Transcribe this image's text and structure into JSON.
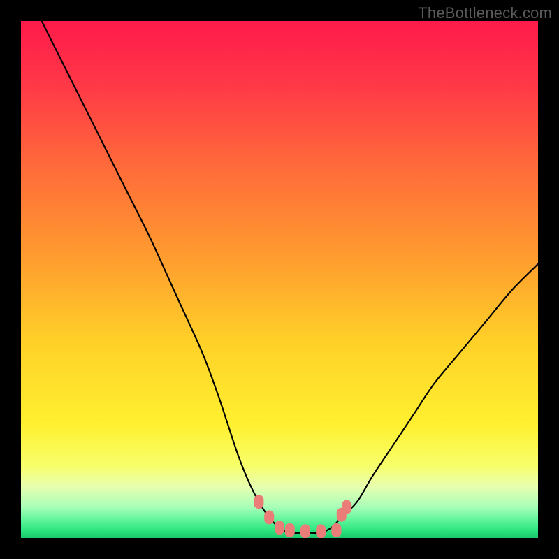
{
  "watermark": "TheBottleneck.com",
  "chart_data": {
    "type": "line",
    "title": "",
    "xlabel": "",
    "ylabel": "",
    "xlim": [
      0,
      100
    ],
    "ylim": [
      0,
      100
    ],
    "grid": false,
    "legend": false,
    "series": [
      {
        "name": "bottleneck-curve",
        "x": [
          4,
          10,
          15,
          20,
          25,
          30,
          35,
          38,
          40,
          42,
          44,
          46,
          48,
          50,
          52,
          54,
          56,
          58,
          60,
          62,
          65,
          68,
          72,
          76,
          80,
          85,
          90,
          95,
          100
        ],
        "y": [
          100,
          88,
          78,
          68,
          58,
          47,
          36,
          28,
          22,
          16,
          11,
          7,
          4,
          2,
          1,
          1,
          1,
          1,
          2,
          4,
          7,
          12,
          18,
          24,
          30,
          36,
          42,
          48,
          53
        ]
      }
    ],
    "markers": {
      "name": "highlight-dots",
      "color": "#eb7d78",
      "points_x": [
        46,
        48,
        50,
        52,
        55,
        58,
        61,
        62,
        63
      ],
      "points_y": [
        7,
        4,
        2,
        1.5,
        1.3,
        1.3,
        1.5,
        4.5,
        6
      ]
    },
    "background_gradient_stops": [
      {
        "offset": 0.0,
        "color": "#ff1a4a"
      },
      {
        "offset": 0.12,
        "color": "#ff3747"
      },
      {
        "offset": 0.28,
        "color": "#ff6a3a"
      },
      {
        "offset": 0.45,
        "color": "#ff9a2f"
      },
      {
        "offset": 0.62,
        "color": "#ffd028"
      },
      {
        "offset": 0.78,
        "color": "#fff030"
      },
      {
        "offset": 0.86,
        "color": "#f7ff6a"
      },
      {
        "offset": 0.9,
        "color": "#e8ffb0"
      },
      {
        "offset": 0.94,
        "color": "#a8ffb8"
      },
      {
        "offset": 0.965,
        "color": "#60f59a"
      },
      {
        "offset": 0.985,
        "color": "#2de57f"
      },
      {
        "offset": 1.0,
        "color": "#17c76b"
      }
    ]
  }
}
